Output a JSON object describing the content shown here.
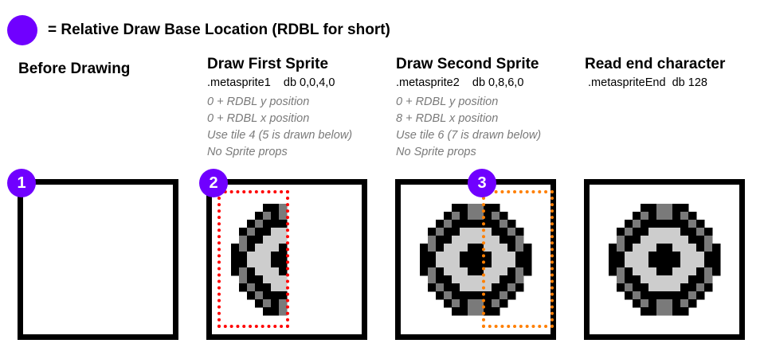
{
  "legend": {
    "text": "= Relative Draw Base Location (RDBL for short)",
    "marker_color": "#7000ff"
  },
  "columns": [
    {
      "title": "Before Drawing",
      "badge": "1"
    },
    {
      "title": "Draw First Sprite",
      "code": ".metasprite1    db 0,0,4,0",
      "notes": [
        "0 + RDBL y position",
        "0 + RDBL x position",
        "Use tile 4 (5 is drawn below)",
        "No Sprite props"
      ],
      "badge": "2",
      "box_color": "#ff0000"
    },
    {
      "title": "Draw Second Sprite",
      "code": ".metasprite2    db 0,8,6,0",
      "notes": [
        "0 + RDBL y position",
        "8 + RDBL x position",
        "Use tile 6 (7 is drawn below)",
        "No Sprite props"
      ],
      "badge": "3",
      "box_color": "#ff7f00"
    },
    {
      "title": "Read end character",
      "code": " .metaspriteEnd  db 128"
    }
  ],
  "palette": [
    "#ffffff",
    "#000000",
    "#7a7a7a",
    "#cdcdcd"
  ]
}
